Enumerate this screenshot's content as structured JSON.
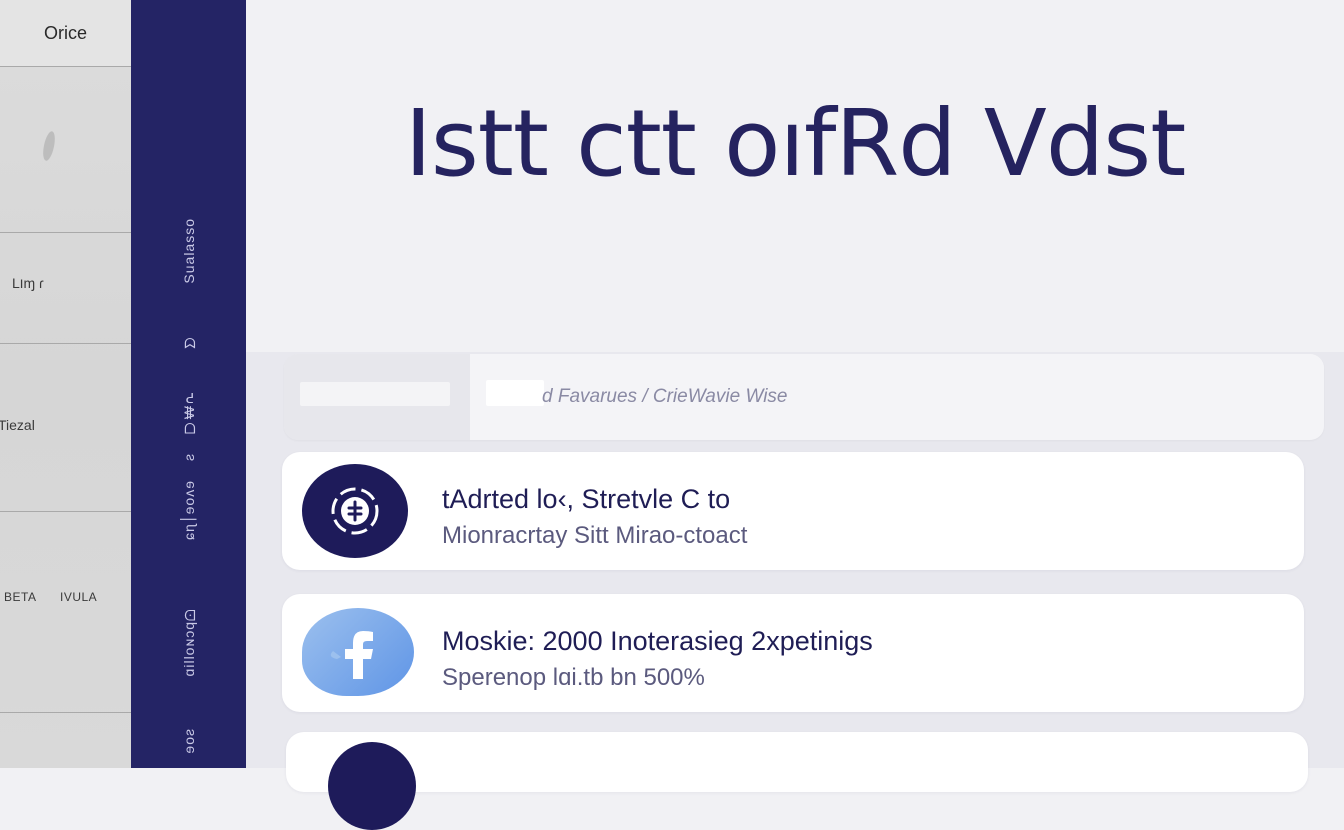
{
  "left_pane": {
    "title": "Orice",
    "labels": [
      "Lוɱ  ɾ",
      "Tiezal"
    ],
    "footer_left": "BETA",
    "footer_right": "IVULA"
  },
  "rail": {
    "labels": [
      "Sualasso",
      "ᗢ",
      "ᗜ₩ᕈ",
      "ƨ",
      "ɕɳ׀ɘoʌɘ",
      "ɑilloɴɔqᗠ",
      "ɘoƨ"
    ]
  },
  "hero": {
    "title": "Istt ctt oıfRd Vdst"
  },
  "search": {
    "text": "d Favarues / CrieWavie Wise"
  },
  "cards": [
    {
      "title": "tAdrted lo‹, Stretvle C to",
      "subtitle": "Mionracrtay Sitt   Mirao-ctoact",
      "icon": "badge-icon",
      "icon_color": "#1e1b5a"
    },
    {
      "title": "Moskie: 2000 Inoterasieg 2xpetinigs",
      "subtitle": "Sperenop  lɑi.tb  bn  500%",
      "icon": "facebook-f-icon",
      "icon_color": "#6a9fe8"
    },
    {
      "title": "",
      "subtitle": "",
      "icon": "partial-circle-icon",
      "icon_color": "#1e1b5a"
    }
  ],
  "colors": {
    "navy": "#242465",
    "hero_text": "#25235f",
    "background": "#f1f1f4"
  }
}
